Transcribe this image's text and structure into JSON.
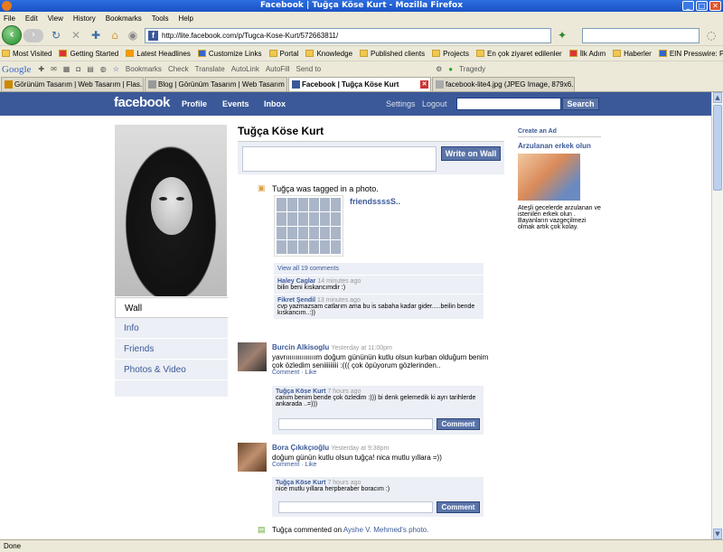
{
  "window": {
    "title": "Facebook | Tuğça Köse Kurt - Mozilla Firefox"
  },
  "menu": [
    "File",
    "Edit",
    "View",
    "History",
    "Bookmarks",
    "Tools",
    "Help"
  ],
  "url": "http://lite.facebook.com/p/Tugca-Kose-Kurt/572663811/",
  "bookmarks": [
    "Most Visited",
    "Getting Started",
    "Latest Headlines",
    "Customize Links",
    "Portal",
    "Knowledge",
    "Published clients",
    "Projects",
    "En çok ziyaret edilenler",
    "İlk Adım",
    "Haberler",
    "EIN Presswire: Press ..."
  ],
  "toolbar2": {
    "google": "Google",
    "bookmarks": "Bookmarks",
    "check": "Check",
    "translate": "Translate",
    "autolink": "AutoLink",
    "autofill": "AutoFill",
    "sendto": "Send to",
    "tragedy": "Tragedy"
  },
  "tabs": [
    {
      "label": "Görünüm Tasarım | Web Tasarım | Flas...",
      "active": false
    },
    {
      "label": "Blog | Görünüm Tasarım | Web Tasarım ...",
      "active": false
    },
    {
      "label": "Facebook | Tuğça Köse Kurt",
      "active": true
    },
    {
      "label": "facebook-lite4.jpg (JPEG Image, 879x6...",
      "active": false
    }
  ],
  "status": "Done",
  "fb": {
    "logo": "facebook",
    "nav": {
      "profile": "Profile",
      "events": "Events",
      "inbox": "Inbox",
      "settings": "Settings",
      "logout": "Logout",
      "search": "Search"
    },
    "profile_name": "Tuğça Köse Kurt",
    "write_on_wall": "Write on Wall",
    "left_nav": [
      "Wall",
      "Info",
      "Friends",
      "Photos & Video"
    ],
    "story1": {
      "text": "Tuğça was tagged in a photo.",
      "album": "friendssssS..",
      "view_all": "View all 19 comments",
      "comments": [
        {
          "author": "Haley Caglar",
          "time": "14 minutes ago",
          "text": "bilin beni kıskancımdir :)"
        },
        {
          "author": "Fikret Şendil",
          "time": "13 minutes ago",
          "text": "cvp yazmazsam catlarım ama bu is sabaha kadar gider.....beilin bende kıskancım..:))"
        }
      ]
    },
    "post1": {
      "author": "Burcin Alkisoglu",
      "time": "Yesterday at 11:00pm",
      "text": "yavrııııııııııııııım doğum gününün kutlu olsun kurban olduğum benim çok özledim seniiiiiiiii :((( çok öpüyorum gözlerinden..",
      "actions": "Comment · Like",
      "reply_author": "Tuğça Köse Kurt",
      "reply_time": "7 hours ago",
      "reply_text": "canım benim bende çok özledim :))) bi denk gelemedik ki ayrı tarihlerde ankarada ..=)))",
      "comment_btn": "Comment"
    },
    "post2": {
      "author": "Bora Çıkıkçıoğlu",
      "time": "Yesterday at 9:38pm",
      "text": "doğum günün kutlu olsun tuğça! nica mutlu yıllara =))",
      "actions": "Comment · Like",
      "reply_author": "Tuğça Köse Kurt",
      "reply_time": "7 hours ago",
      "reply_text": "nice mutlu yıllara herpberaber boracım :)",
      "comment_btn": "Comment"
    },
    "story2": {
      "prefix": "Tuğça commented on",
      "link": "Ayshe V. Mehmed's photo."
    },
    "ad": {
      "create": "Create an Ad",
      "title": "Arzulanan erkek olun",
      "body": "Ateşli gecelerde arzulanan ve istenilen erkek olun . Bayanların vazgeçilmezi olmak artık çok kolay."
    }
  }
}
